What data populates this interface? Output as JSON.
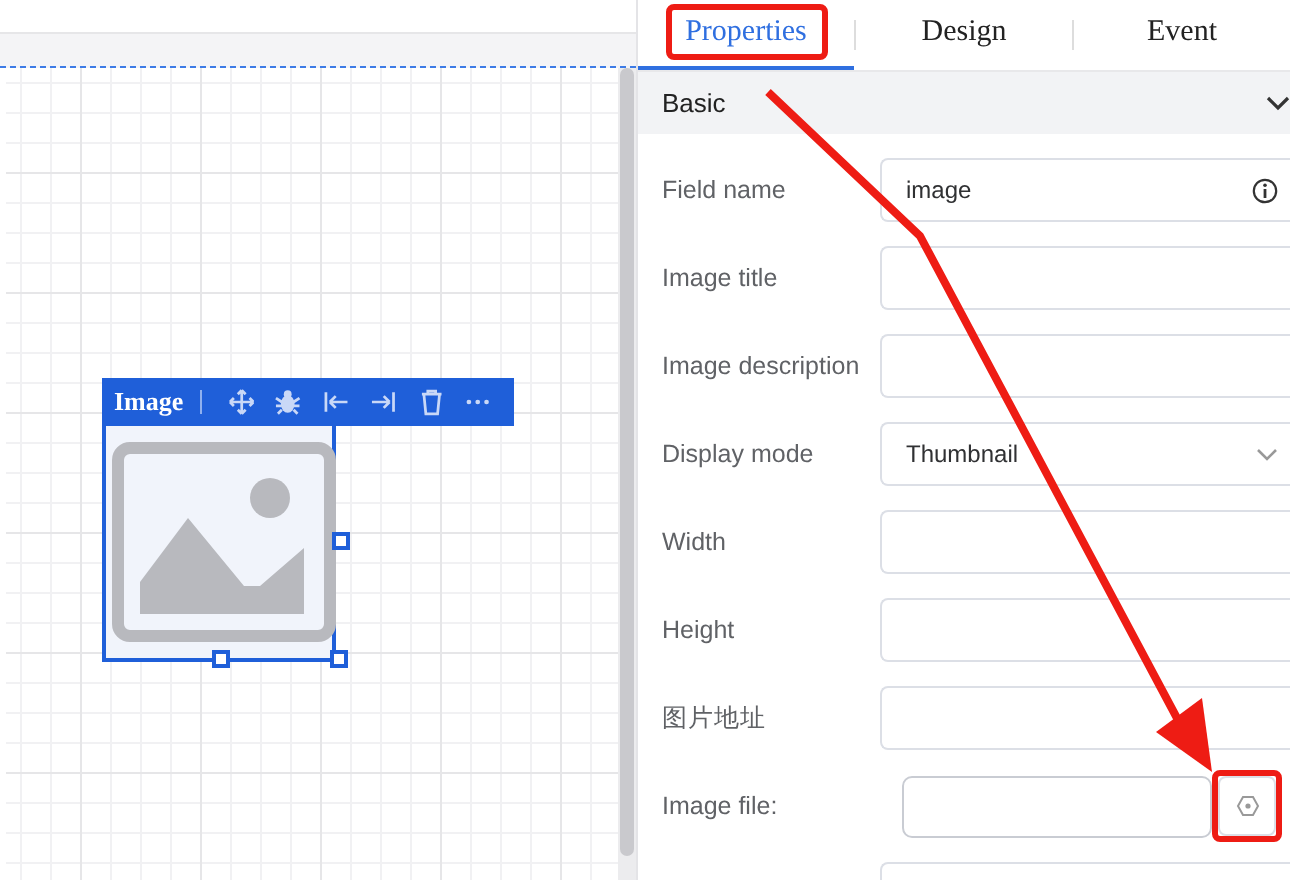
{
  "canvas": {
    "widget": {
      "title": "Image",
      "selected": true,
      "tools": [
        {
          "kind": "move"
        },
        {
          "kind": "bug"
        },
        {
          "kind": "indent-left"
        },
        {
          "kind": "indent-right"
        },
        {
          "kind": "delete"
        },
        {
          "kind": "more"
        }
      ]
    }
  },
  "tabs": [
    {
      "label": "Properties",
      "selected": true
    },
    {
      "label": "Design",
      "selected": false
    },
    {
      "label": "Event",
      "selected": false
    }
  ],
  "section": {
    "title": "Basic",
    "expanded": true
  },
  "fields": [
    {
      "kind": "text",
      "label": "Field name",
      "value": "image",
      "info": true
    },
    {
      "kind": "text",
      "label": "Image title"
    },
    {
      "kind": "text",
      "label": "Image description"
    },
    {
      "kind": "select",
      "label": "Display mode",
      "value": "Thumbnail"
    },
    {
      "kind": "text",
      "label": "Width"
    },
    {
      "kind": "text",
      "label": "Height"
    },
    {
      "kind": "text",
      "label": "图片地址"
    },
    {
      "kind": "file",
      "label": "Image file:"
    },
    {
      "kind": "text"
    }
  ]
}
